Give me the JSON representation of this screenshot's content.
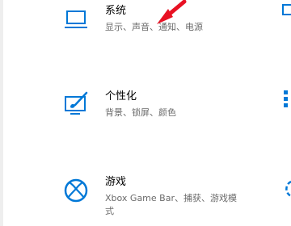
{
  "accent_color": "#0078d7",
  "arrow_color": "#e81123",
  "items": [
    {
      "title": "系统",
      "description": "显示、声音、通知、电源",
      "icon": "laptop-icon"
    },
    {
      "title": "个性化",
      "description": "背景、锁屏、颜色",
      "icon": "personalization-brush-icon"
    },
    {
      "title": "游戏",
      "description": "Xbox Game Bar、捕获、游戏模式",
      "icon": "xbox-icon"
    }
  ]
}
